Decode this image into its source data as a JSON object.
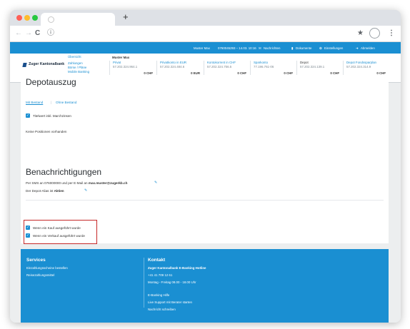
{
  "browser": {
    "tab_title": "",
    "new_tab_glyph": "+",
    "back_icon": "←",
    "forward_icon": "→",
    "reload_icon": "C",
    "info_icon": "ⓘ",
    "star_icon": "★",
    "menu_icon": "⋮",
    "traffic_lights": [
      "#ff5f57",
      "#febc2e",
      "#28c840"
    ]
  },
  "topbar": {
    "user": "Muster Max",
    "contract": "0760045293 – 14.03. 10:16",
    "messages": "Nachrichten",
    "documents": "Dokumente",
    "settings": "Einstellungen",
    "logout": "Abmelden",
    "accent": "#1a8fd2"
  },
  "brand": {
    "name": "Zuger Kantonalbank"
  },
  "nav": [
    "Übersicht",
    "Zahlungen",
    "Börse / Pläne",
    "Mobile Banking"
  ],
  "accounts_owner": "Muster Max",
  "accounts": [
    {
      "name": "Privat",
      "number": "57.202.324.964.1",
      "balance": "0 CHF"
    },
    {
      "name": "Privatkonto in EUR",
      "number": "57.202.324.484.6",
      "balance": "0 EUR"
    },
    {
      "name": "Kontokorrent in CHF",
      "number": "57.202.324.756.5",
      "balance": "0 CHF"
    },
    {
      "name": "Sparkonto",
      "number": "77.196.761-06",
      "balance": "0 CHF"
    },
    {
      "name": "Depot",
      "number": "57.202.324.139.1",
      "balance": "0 CHF"
    },
    {
      "name": "Depot Fondssparplan",
      "number": "57.202.324.314.9",
      "balance": "0 CHF"
    }
  ],
  "depot": {
    "title": "Depotauszug",
    "filter_with": "Mit Bestand",
    "filter_without": "Ohne Bestand",
    "checkbox_label": "Titelwert inkl. Marchzinsen",
    "empty": "Keine Positionen vorhanden"
  },
  "notifications": {
    "title": "Benachrichtigungen",
    "sms_prefix": "Per SMS an 076000000 und per E-Mail an ",
    "email": "max.muster@zugerkb.ch",
    "alias_prefix": "Der Depot-Alias ist ",
    "alias": "Aktien",
    "option_buy": "Wenn ein Kauf ausgeführt wurde",
    "option_sell": "Wenn ein Verkauf ausgeführt wurde",
    "highlight_color": "#c62828"
  },
  "footer": {
    "services_title": "Services",
    "services": [
      "Einzahlungsscheine bestellen",
      "Reisezahlungsmittel"
    ],
    "contact_title": "Kontakt",
    "hotline_title": "Zuger Kantonalbank E-Banking Hotline",
    "phone": "+41 41 709 12 61",
    "hours": "Montag - Freitag 08.00 - 18.00 Uhr",
    "help_title": "E-Banking Hilfe",
    "live_support": "Live Support mit Berater starten",
    "write_message": "Nachricht schreiben"
  }
}
